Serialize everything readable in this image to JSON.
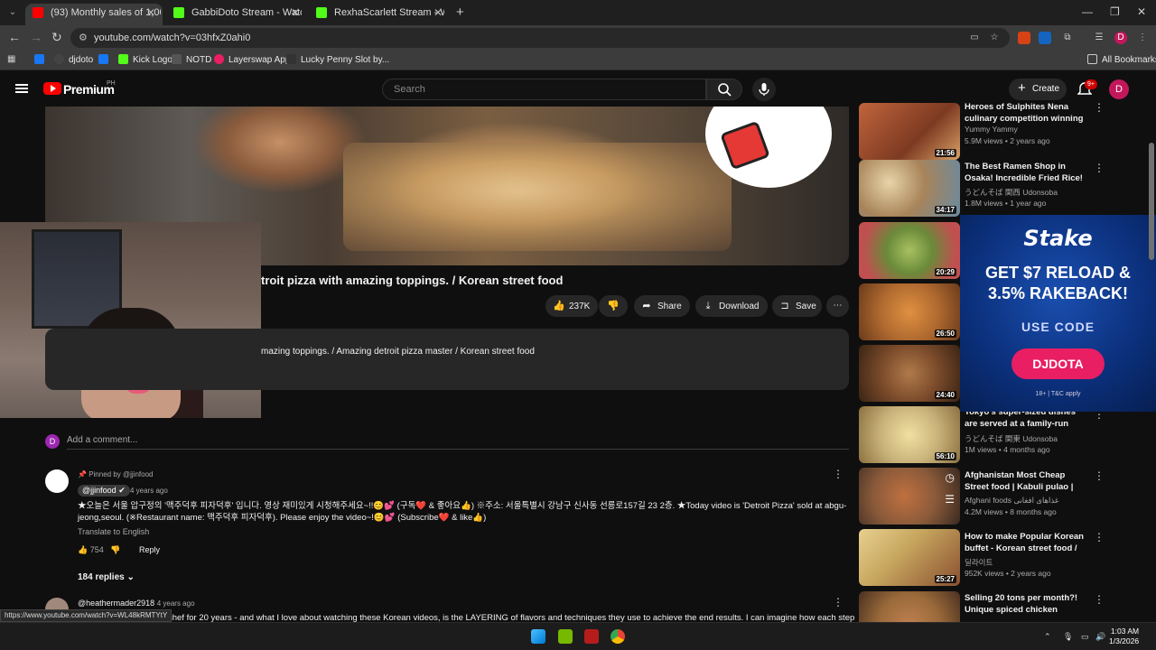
{
  "browser": {
    "tabs": [
      {
        "label": "(93) Monthly sales of 1,000,000",
        "favicon_color": "#ff0000",
        "active": true
      },
      {
        "label": "GabbiDoto Stream - Watch Live",
        "favicon_color": "#53fc18",
        "active": false
      },
      {
        "label": "RexhaScarlett Stream - Watch L",
        "favicon_color": "#53fc18",
        "active": false
      }
    ],
    "url": "youtube.com/watch?v=03hfxZ0ahi0",
    "bookmarks": [
      {
        "label": "",
        "color": "#1877f2"
      },
      {
        "label": "djdoto",
        "color": "#444444"
      },
      {
        "label": "",
        "color": "#1877f2"
      },
      {
        "label": "Kick Logo",
        "color": "#53fc18"
      },
      {
        "label": "NOTD",
        "color": "#222222"
      },
      {
        "label": "Layerswap App",
        "color": "#e91e63"
      },
      {
        "label": "Lucky Penny Slot by...",
        "color": "#333333"
      }
    ],
    "all_bookmarks": "All Bookmarks"
  },
  "header": {
    "brand": "Premium",
    "region": "PH",
    "search_placeholder": "Search",
    "create_label": "Create",
    "notif_badge": "9+",
    "avatar_letter": "D"
  },
  "video": {
    "title": "troit pizza with amazing toppings. / Korean street food",
    "actions": {
      "likes": "237K",
      "share": "Share",
      "download": "Download",
      "save": "Save"
    },
    "description": "mazing toppings. / Amazing detroit pizza master / Korean street food"
  },
  "comments": {
    "avatar_letter": "D",
    "add_placeholder": "Add a comment...",
    "pinned": {
      "pinned_by": "Pinned by @jjinfood",
      "author": "@jjinfood",
      "age": "4 years ago",
      "text": "★오늘은 서울 압구정의 '맥주덕후 피자덕후' 입니다. 영상 재미있게 시청해주세요~!!😊💕 (구독❤️ & 좋아요👍) ※주소: 서울특별시 강남구 신사동 선릉로157길 23 2층. ★Today video is 'Detroit Pizza' sold at abgu-jeong,seoul. (※Restaurant name: 맥주덕후 피자덕후). Please enjoy the video~!😊💕 (Subscribe❤️ & like👍)",
      "translate": "Translate to English",
      "likes": "754",
      "reply": "Reply",
      "replies": "184 replies"
    },
    "second": {
      "author": "@heathermader2918",
      "age": "4 years ago",
      "text": "chef for 20 years - and what I love about watching these Korean videos, is the LAYERING of flavors and techniques they use to achieve the end results. I can imagine how each step"
    },
    "hover_url": "https://www.youtube.com/watch?v=WL48kRMTYtY"
  },
  "sidebar": [
    {
      "title": "Heroes of Sulphites Nena culinary competition winning ...",
      "channel": "Yummy Yammy",
      "meta": "5.9M views • 2 years ago",
      "duration": "21:56",
      "color": "#b5573a"
    },
    {
      "title": "The Best Ramen Shop in Osaka! Incredible Fried Rice! Amazing...",
      "channel": "うどんそば 関西 Udonsoba",
      "meta": "1.8M views • 1 year ago",
      "duration": "34:17",
      "color": "#a88a5a"
    },
    {
      "title": "",
      "channel": "",
      "meta": "",
      "duration": "20:29",
      "color": "#6b8a3a"
    },
    {
      "title": "",
      "channel": "",
      "meta": "",
      "duration": "26:50",
      "color": "#b06a30"
    },
    {
      "title": "",
      "channel": "",
      "meta": "",
      "duration": "24:40",
      "color": "#7a4a2a"
    },
    {
      "title": "Tokyo's super-sized dishes are served at a family-run Chinese...",
      "channel": "うどんそば 関東 Udonsoba",
      "meta": "1M views • 4 months ago",
      "duration": "56:10",
      "color": "#c9b27a"
    },
    {
      "title": "Afghanistan Most Cheap Street food | Kabuli pulao | Biryani | ...",
      "channel": "Afghani foods غذاهای افغانی",
      "meta": "4.2M views • 8 months ago",
      "duration": "",
      "color": "#8a5a3a"
    },
    {
      "title": "How to make Popular Korean buffet - Korean street food / 부...",
      "channel": "딜라이트",
      "meta": "952K views • 2 years ago",
      "duration": "25:27",
      "color": "#c8a860"
    },
    {
      "title": "Selling 20 tons per month?! Unique spiced chicken served ...",
      "channel": "",
      "meta": "",
      "duration": "",
      "color": "#9a6a3a"
    }
  ],
  "ad": {
    "brand": "Stake",
    "headline1": "GET $7 RELOAD &",
    "headline2": "3.5% RAKEBACK!",
    "code_label": "USE CODE",
    "code": "DJDOTA",
    "terms": "18+ | T&C apply"
  },
  "taskbar": {
    "time": "1:03 AM",
    "date": "1/3/2026"
  }
}
